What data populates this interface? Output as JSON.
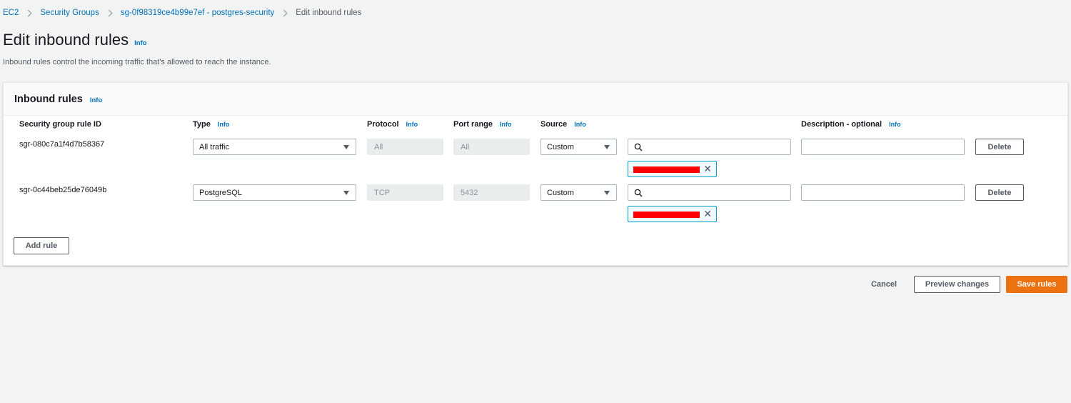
{
  "breadcrumb": {
    "items": [
      "EC2",
      "Security Groups",
      "sg-0f98319ce4b99e7ef - postgres-security"
    ],
    "current": "Edit inbound rules"
  },
  "page": {
    "title": "Edit inbound rules",
    "info": "Info",
    "description": "Inbound rules control the incoming traffic that's allowed to reach the instance."
  },
  "panel": {
    "title": "Inbound rules",
    "info": "Info",
    "columns": {
      "rule_id": "Security group rule ID",
      "type": "Type",
      "protocol": "Protocol",
      "port_range": "Port range",
      "source": "Source",
      "description": "Description - optional",
      "info": "Info"
    },
    "rows": [
      {
        "rule_id": "sgr-080c7a1f4d7b58367",
        "type": "All traffic",
        "protocol": "All",
        "port_range": "All",
        "source": "Custom",
        "search_value": "",
        "description_value": "",
        "delete_label": "Delete"
      },
      {
        "rule_id": "sgr-0c44beb25de76049b",
        "type": "PostgreSQL",
        "protocol": "TCP",
        "port_range": "5432",
        "source": "Custom",
        "search_value": "",
        "description_value": "",
        "delete_label": "Delete"
      }
    ],
    "add_rule_label": "Add rule"
  },
  "footer": {
    "cancel_label": "Cancel",
    "preview_label": "Preview changes",
    "save_label": "Save rules"
  },
  "colors": {
    "link": "#0073bb",
    "primary_button": "#ec7211",
    "token_border": "#00a1c9",
    "redaction": "#ff0000"
  }
}
